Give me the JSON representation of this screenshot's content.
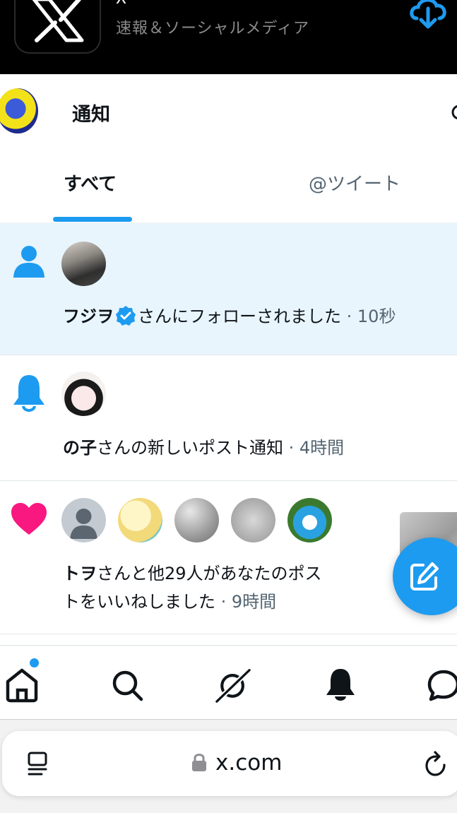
{
  "app_banner": {
    "name": "X",
    "subtitle": "速報＆ソーシャルメディア",
    "icon": "x-logo-icon",
    "action_icon": "cloud-download-icon"
  },
  "header": {
    "title": "通知",
    "avatar_icon": "user-avatar",
    "settings_icon": "gear-icon"
  },
  "tabs": [
    {
      "label": "すべて",
      "active": true
    },
    {
      "label": "@ツイート",
      "active": false
    }
  ],
  "notifications": [
    {
      "type": "follow",
      "icon": "person-icon",
      "user": "フジヲ",
      "verified": true,
      "message": "さんにフォローされました",
      "time": "· 10秒",
      "highlighted": true
    },
    {
      "type": "post_notify",
      "icon": "bell-icon",
      "user": "の子",
      "message": "さんの新しいポスト通知",
      "time": "· 4時間"
    },
    {
      "type": "likes",
      "icon": "heart-icon",
      "user": "トヲ",
      "message_line1": "さんと他29人があなたのポス",
      "message_line2": "トをいいねしました",
      "time": "· 9時間"
    }
  ],
  "fab": {
    "icon": "compose-icon"
  },
  "bottom_nav": [
    {
      "name": "home-icon",
      "has_dot": true
    },
    {
      "name": "search-icon"
    },
    {
      "name": "grok-icon"
    },
    {
      "name": "bell-icon"
    },
    {
      "name": "messages-icon"
    }
  ],
  "browser": {
    "url": "x.com",
    "tabs_icon": "tabs-icon",
    "lock_icon": "lock-icon",
    "reload_icon": "reload-icon"
  },
  "colors": {
    "accent": "#1d9bf0",
    "like": "#f91880",
    "highlight_bg": "#e8f5fd",
    "secondary_text": "#536471"
  }
}
